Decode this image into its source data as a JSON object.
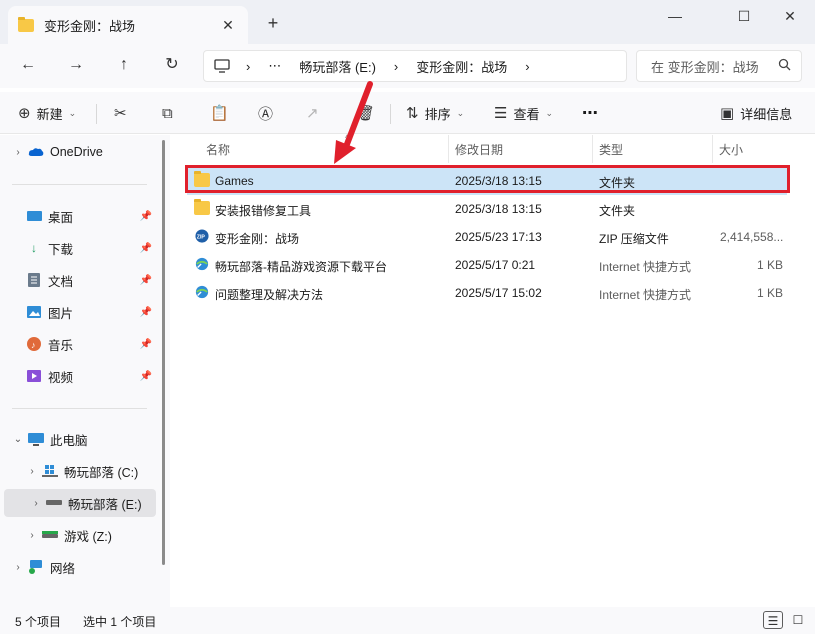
{
  "window": {
    "tab_title": "变形金刚：战场",
    "close_tab_glyph": "✕",
    "new_tab_glyph": "+",
    "minimize_glyph": "—",
    "maximize_glyph": "☐",
    "close_glyph": "✕"
  },
  "nav": {
    "back_glyph": "←",
    "forward_glyph": "→",
    "up_glyph": "↑",
    "refresh_glyph": "↻",
    "breadcrumb": [
      "⋯",
      "畅玩部落 (E:)",
      "变形金刚：战场"
    ],
    "search_placeholder": "在 变形金刚：战场",
    "search_icon": "search-icon"
  },
  "toolbar": {
    "new_label": "新建",
    "sort_label": "排序",
    "view_label": "查看",
    "more_label": "⋯",
    "details_label": "详细信息"
  },
  "sidebar": {
    "onedrive": "OneDrive",
    "quick": [
      {
        "label": "桌面",
        "icon": "desktop-icon"
      },
      {
        "label": "下载",
        "icon": "download-icon"
      },
      {
        "label": "文档",
        "icon": "document-icon"
      },
      {
        "label": "图片",
        "icon": "pictures-icon"
      },
      {
        "label": "音乐",
        "icon": "music-icon"
      },
      {
        "label": "视频",
        "icon": "video-icon"
      }
    ],
    "this_pc": "此电脑",
    "drives": [
      {
        "label": "畅玩部落 (C:)"
      },
      {
        "label": "畅玩部落 (E:)"
      },
      {
        "label": "游戏 (Z:)"
      }
    ],
    "network": "网络"
  },
  "columns": {
    "name": "名称",
    "modified": "修改日期",
    "type": "类型",
    "size": "大小"
  },
  "files": [
    {
      "name": "Games",
      "modified": "2025/3/18 13:15",
      "type": "文件夹",
      "size": "",
      "icon": "folder-icon"
    },
    {
      "name": "安装报错修复工具",
      "modified": "2025/3/18 13:15",
      "type": "文件夹",
      "size": "",
      "icon": "folder-icon"
    },
    {
      "name": "变形金刚：战场",
      "modified": "2025/5/23 17:13",
      "type": "ZIP 压缩文件",
      "size": "2,414,558...",
      "icon": "zip-icon"
    },
    {
      "name": "畅玩部落-精品游戏资源下载平台",
      "modified": "2025/5/17 0:21",
      "type": "Internet 快捷方式",
      "size": "1 KB",
      "icon": "internet-shortcut-icon"
    },
    {
      "name": "问题整理及解决方法",
      "modified": "2025/5/17 15:02",
      "type": "Internet 快捷方式",
      "size": "1 KB",
      "icon": "internet-shortcut-icon"
    }
  ],
  "status": {
    "count": "5 个项目",
    "selected": "选中 1 个项目"
  },
  "colors": {
    "selection": "#cce4f7",
    "highlight_border": "#e0202c",
    "arrow": "#e0202c",
    "folder": "#f8c846"
  }
}
